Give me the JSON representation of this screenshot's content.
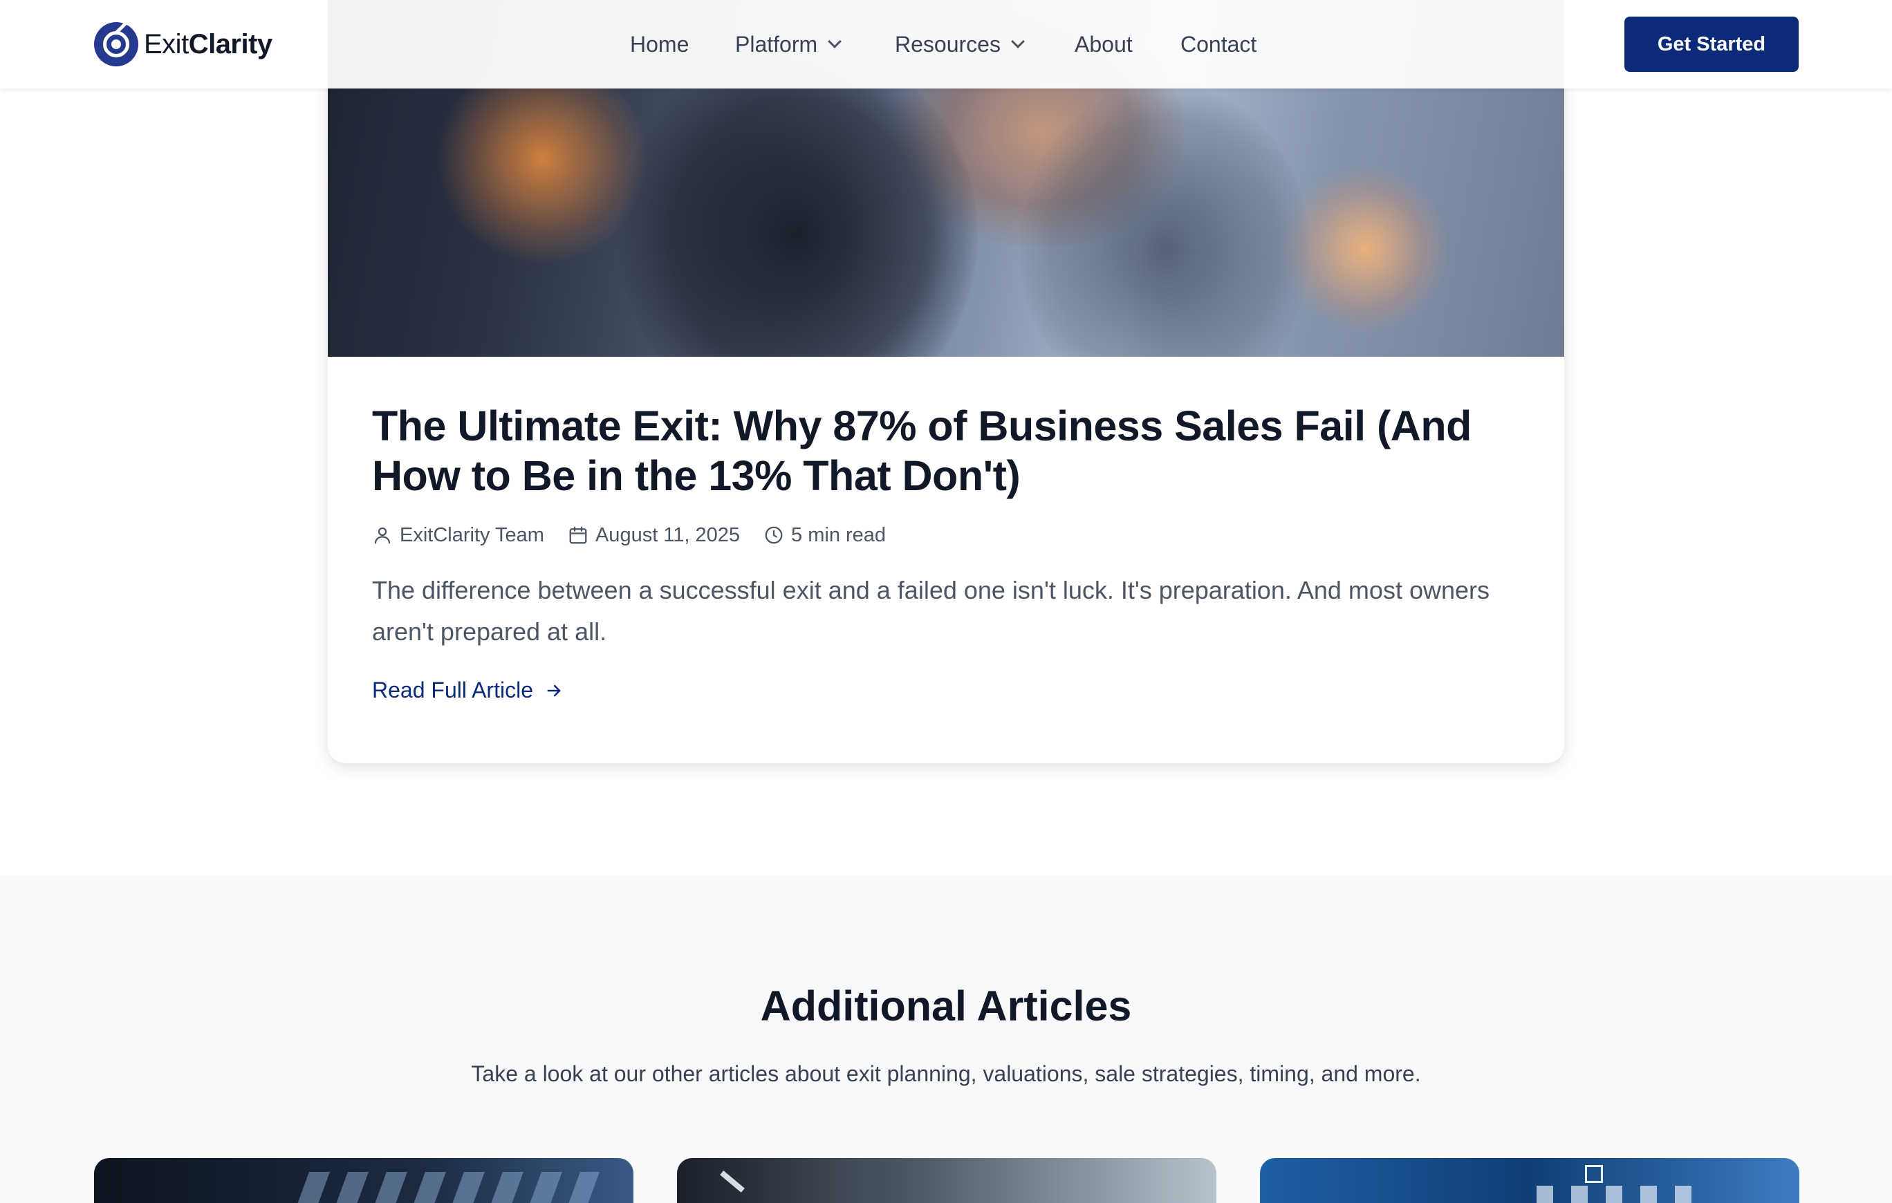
{
  "header": {
    "brand": {
      "prefix": "Exit",
      "suffix": "Clarity"
    },
    "nav": [
      {
        "label": "Home",
        "dropdown": false
      },
      {
        "label": "Platform",
        "dropdown": true
      },
      {
        "label": "Resources",
        "dropdown": true
      },
      {
        "label": "About",
        "dropdown": false
      },
      {
        "label": "Contact",
        "dropdown": false
      }
    ],
    "cta_label": "Get Started"
  },
  "featured": {
    "image_icon": "handshake-photo",
    "title": "The Ultimate Exit: Why 87% of Business Sales Fail (And How to Be in the 13% That Don't)",
    "author": "ExitClarity Team",
    "date": "August 11, 2025",
    "read_time": "5 min read",
    "excerpt": "The difference between a successful exit and a failed one isn't luck. It's preparation. And most owners aren't prepared at all.",
    "link_label": "Read Full Article"
  },
  "additional": {
    "title": "Additional Articles",
    "subtitle": "Take a look at our other articles about exit planning, valuations, sale strategies, timing, and more."
  },
  "colors": {
    "brand_navy": "#0c2a7a",
    "logo_blue": "#253a8e",
    "section_bg": "#f8f9fb"
  }
}
